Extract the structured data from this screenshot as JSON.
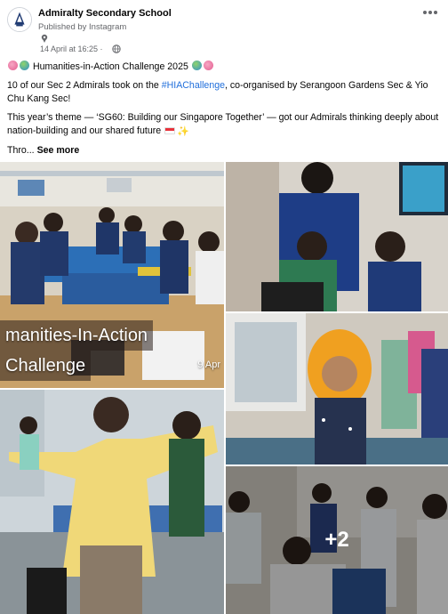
{
  "post": {
    "page_name": "Admiralty Secondary School",
    "published_by": "Published by Instagram",
    "date": "14 April at 16:25 ·",
    "paragraphs": {
      "title": "Humanities-in-Action Challenge 2025",
      "p1_before": "10 of our Sec 2 Admirals took on the ",
      "hashtag": "#HIAChallenge",
      "p1_after": ", co-organised by Serangoon Gardens Sec & Yio Chu Kang Sec!",
      "p2": "This year’s theme — ‘SG60: Building our Singapore Together’ — got our Admirals thinking deeply about nation-building and our shared future",
      "p3": "Thro... ",
      "see_more": "See more"
    }
  },
  "photos": {
    "overlay_line1": "manities-In-Action",
    "overlay_line2": "Challenge",
    "overlay_date": "9 Apr",
    "more_count": "+2"
  },
  "icons": {
    "avatar": "school-crest-icon",
    "pin": "pin-icon",
    "audience": "globe-icon",
    "menu": "more-options-icon"
  },
  "colors": {
    "hashtag": "#216fdb",
    "meta": "#65676b"
  }
}
